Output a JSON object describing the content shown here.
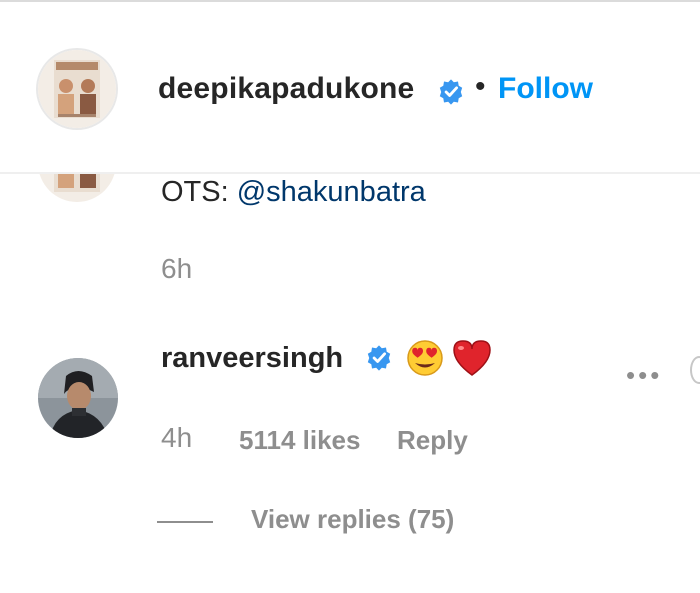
{
  "post_header": {
    "username": "deepikapadukone",
    "separator": "•",
    "follow_label": "Follow",
    "verified_icon": "verified-badge-icon"
  },
  "caption": {
    "prefix": "OTS: ",
    "mention": "@shakunbatra",
    "time": "6h"
  },
  "comment": {
    "username": "ranveersingh",
    "emojis": [
      "heart-eyes-emoji",
      "red-heart-emoji"
    ],
    "time": "4h",
    "likes": "5114 likes",
    "reply_label": "Reply",
    "more_label": "•••",
    "view_replies_label": "View replies (75)"
  },
  "colors": {
    "link_blue": "#0095f6",
    "mention_blue": "#00376b",
    "verified_blue": "#3897f0",
    "text_dark": "#262626",
    "text_muted": "#8e8e8e"
  }
}
